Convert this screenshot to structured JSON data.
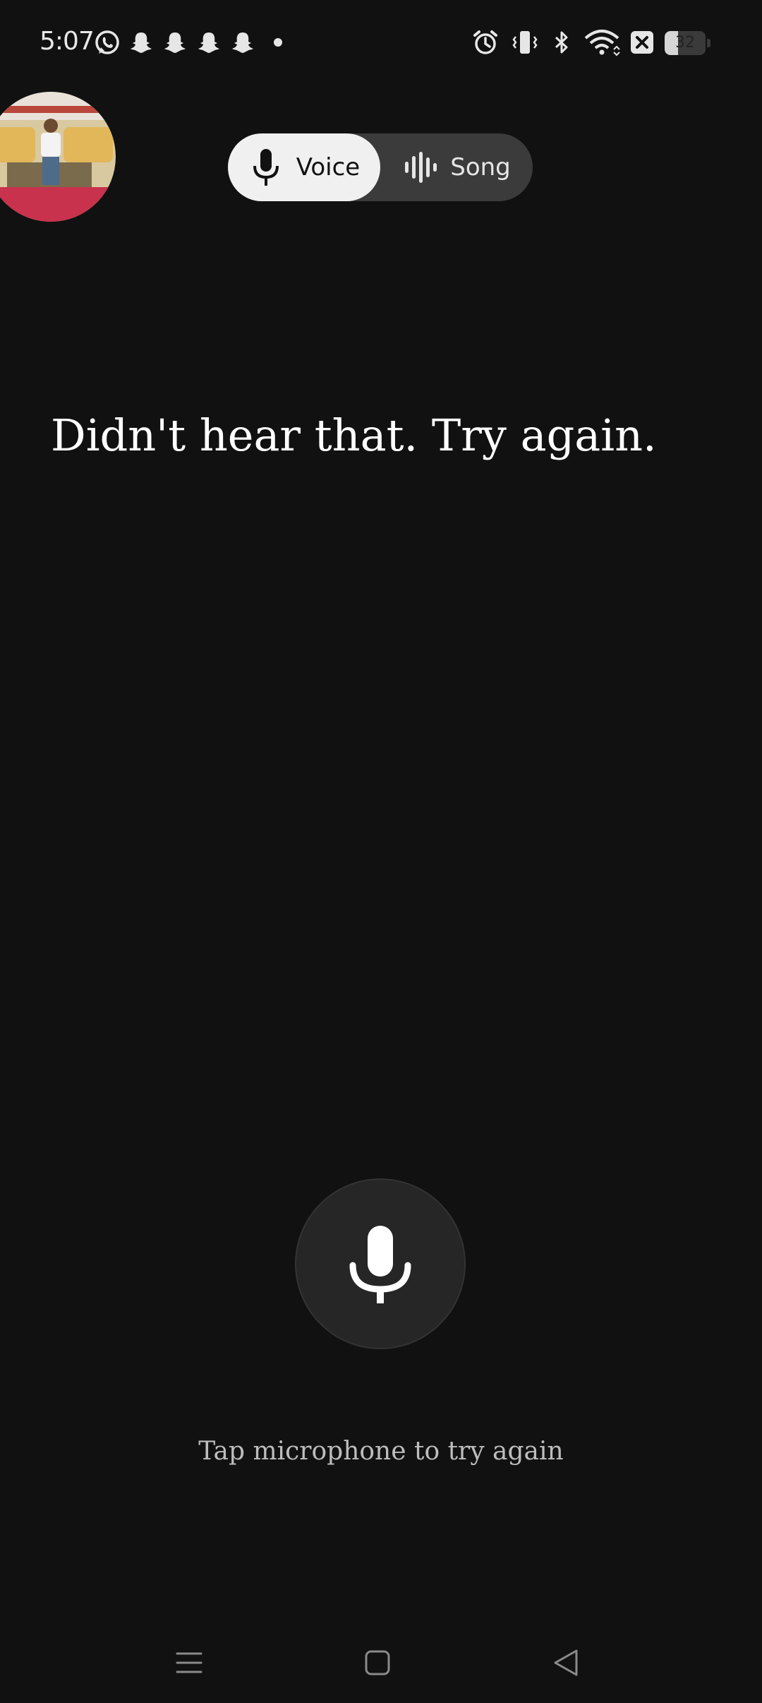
{
  "status_bar": {
    "time": "5:07",
    "notification_icons": [
      "whatsapp-icon",
      "snapchat-icon",
      "snapchat-icon",
      "snapchat-icon",
      "snapchat-icon",
      "more-dot-icon"
    ],
    "system_icons": [
      "alarm-icon",
      "vibrate-icon",
      "bluetooth-icon",
      "wifi-icon",
      "data-off-icon"
    ],
    "battery": {
      "level": 32,
      "text": "32"
    }
  },
  "mode_toggle": {
    "selected": "voice",
    "voice_label": "Voice",
    "song_label": "Song"
  },
  "prompt": {
    "message": "Didn't hear that. Try again."
  },
  "mic": {
    "hint": "Tap microphone to try again"
  },
  "colors": {
    "background": "#111111",
    "toggle_track": "#3b3b3b",
    "toggle_selected": "#f0f0f0",
    "mic_button": "#262626"
  },
  "nav_bar": {
    "buttons": [
      "menu-icon",
      "home-icon",
      "back-icon"
    ]
  }
}
